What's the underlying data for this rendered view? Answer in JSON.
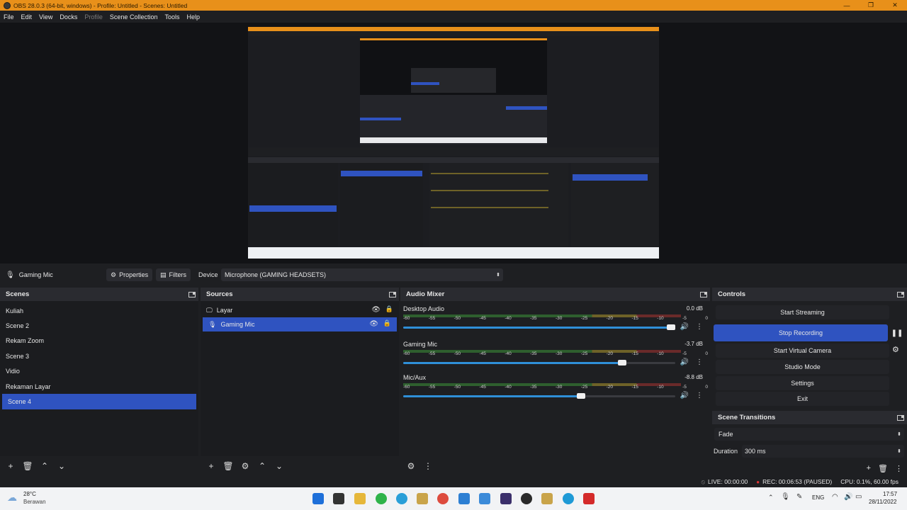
{
  "window": {
    "title": "OBS 28.0.3 (64-bit, windows) - Profile: Untitled - Scenes: Untitled"
  },
  "menu": [
    {
      "label": "File",
      "disabled": false
    },
    {
      "label": "Edit",
      "disabled": false
    },
    {
      "label": "View",
      "disabled": false
    },
    {
      "label": "Docks",
      "disabled": false
    },
    {
      "label": "Profile",
      "disabled": true
    },
    {
      "label": "Scene Collection",
      "disabled": false
    },
    {
      "label": "Tools",
      "disabled": false
    },
    {
      "label": "Help",
      "disabled": false
    }
  ],
  "source_toolbar": {
    "source_name": "Gaming Mic",
    "properties_label": "Properties",
    "filters_label": "Filters",
    "device_label": "Device",
    "device_value": "Microphone (GAMING HEADSETS)"
  },
  "scenes": {
    "title": "Scenes",
    "items": [
      "Kuliah",
      "Scene 2",
      "Rekam Zoom",
      "Scene 3",
      "Vidio",
      "Rekaman Layar",
      "Scene 4"
    ],
    "selected": "Scene 4"
  },
  "sources": {
    "title": "Sources",
    "items": [
      {
        "name": "Layar",
        "icon": "monitor-icon",
        "selected": false
      },
      {
        "name": "Gaming Mic",
        "icon": "microphone-icon",
        "selected": true
      }
    ]
  },
  "audio_mixer": {
    "title": "Audio Mixer",
    "ticks": [
      "-60",
      "-55",
      "-50",
      "-45",
      "-40",
      "-35",
      "-30",
      "-25",
      "-20",
      "-15",
      "-10",
      "-5",
      "0"
    ],
    "channels": [
      {
        "name": "Desktop Audio",
        "db": "0.0 dB",
        "volume": 1.0
      },
      {
        "name": "Gaming Mic",
        "db": "-3.7 dB",
        "volume": 0.82
      },
      {
        "name": "Mic/Aux",
        "db": "-8.8 dB",
        "volume": 0.67
      }
    ]
  },
  "controls": {
    "title": "Controls",
    "start_streaming": "Start Streaming",
    "stop_recording": "Stop Recording",
    "start_virtual_camera": "Start Virtual Camera",
    "studio_mode": "Studio Mode",
    "settings": "Settings",
    "exit": "Exit"
  },
  "scene_transitions": {
    "title": "Scene Transitions",
    "transition": "Fade",
    "duration_label": "Duration",
    "duration_value": "300 ms"
  },
  "status": {
    "live": "LIVE: 00:00:00",
    "rec": "REC: 00:06:53 (PAUSED)",
    "cpu": "CPU: 0.1%, 60.00 fps"
  },
  "taskbar": {
    "weather_temp": "28°C",
    "weather_desc": "Berawan",
    "language": "ENG",
    "time": "17:57",
    "date": "28/11/2022"
  },
  "colors": {
    "accent": "#2f53c0",
    "titlebar": "#e8901a"
  }
}
